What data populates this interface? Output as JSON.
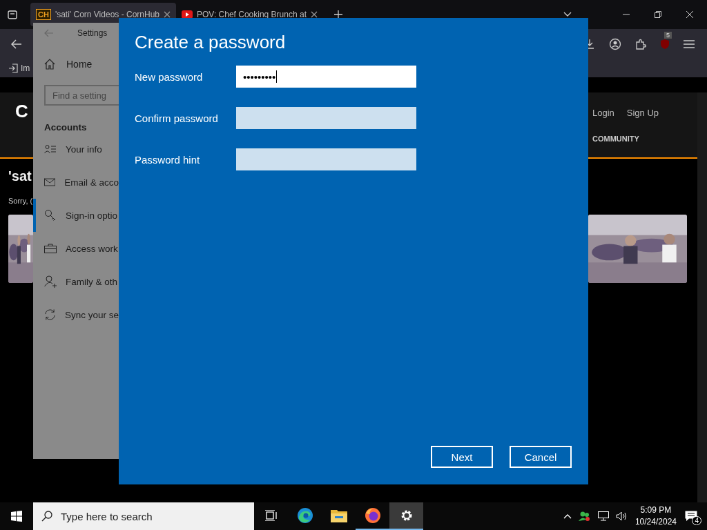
{
  "browser": {
    "tabs": [
      {
        "title": "'sati' Corn Videos - CornHub",
        "icon_text": "CH",
        "selected": true
      },
      {
        "title": "POV: Chef Cooking Brunch at",
        "selected": false
      }
    ],
    "bookmark": "Im",
    "extension_badge": "5",
    "page": {
      "logo": "C",
      "heading": "'sat",
      "notice": "Sorry, (",
      "nav": [
        "Login",
        "Sign Up"
      ],
      "menu_item": "COMMUNITY",
      "thumbnails": [
        {
          "kind": "picture"
        },
        {
          "kind": "picture"
        }
      ]
    }
  },
  "settings": {
    "title": "Settings",
    "home": "Home",
    "search": {
      "placeholder": "Find a setting"
    },
    "section": "Accounts",
    "items": [
      {
        "label": "Your info",
        "selected": false
      },
      {
        "label": "Email & acco",
        "selected": false
      },
      {
        "label": "Sign-in optio",
        "selected": true
      },
      {
        "label": "Access work",
        "selected": false
      },
      {
        "label": "Family & oth",
        "selected": false
      },
      {
        "label": "Sync your se",
        "selected": false
      }
    ]
  },
  "dialog": {
    "title": "Create a password",
    "fields": [
      {
        "label": "New password",
        "value": "•••••••••",
        "focused": true
      },
      {
        "label": "Confirm password",
        "focused": false
      },
      {
        "label": "Password hint",
        "focused": false
      }
    ],
    "buttons": [
      "Next",
      "Cancel"
    ]
  },
  "taskbar": {
    "search": {
      "placeholder": "Type here to search"
    },
    "apps": [
      {
        "running": false,
        "selected": false
      },
      {
        "running": false,
        "selected": false
      },
      {
        "running": false,
        "selected": false
      },
      {
        "running": true,
        "selected": false
      },
      {
        "running": true,
        "selected": true
      }
    ],
    "time": "5:09 PM",
    "date": "10/24/2024",
    "notifications": "4"
  }
}
